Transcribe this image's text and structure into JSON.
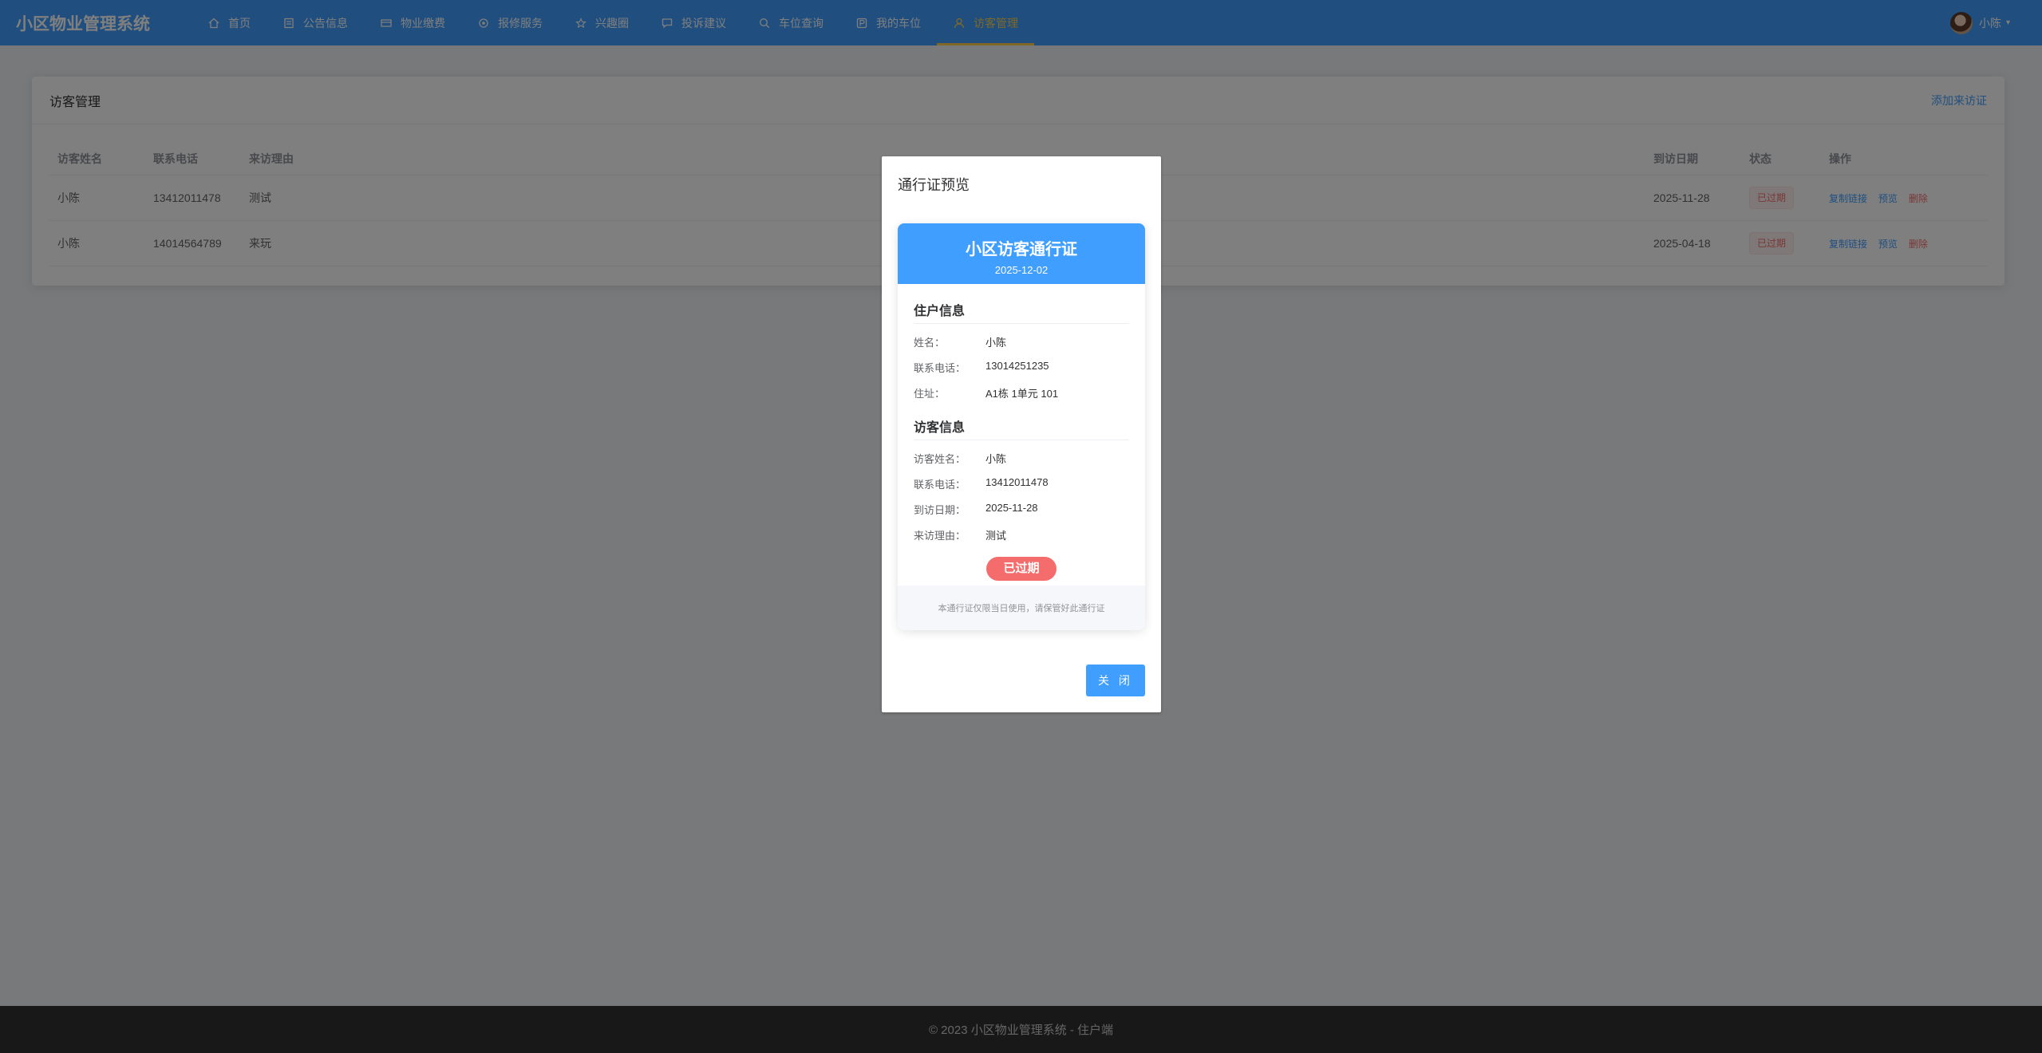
{
  "app": {
    "title": "小区物业管理系统"
  },
  "nav": [
    {
      "label": "首页",
      "icon": "home-icon"
    },
    {
      "label": "公告信息",
      "icon": "notice-icon"
    },
    {
      "label": "物业缴费",
      "icon": "payment-icon"
    },
    {
      "label": "报修服务",
      "icon": "repair-icon"
    },
    {
      "label": "兴趣圈",
      "icon": "circle-icon"
    },
    {
      "label": "投诉建议",
      "icon": "complaint-icon"
    },
    {
      "label": "车位查询",
      "icon": "parking-icon"
    },
    {
      "label": "我的车位",
      "icon": "my-parking-icon"
    },
    {
      "label": "访客管理",
      "icon": "user-icon",
      "active": true
    }
  ],
  "user": {
    "name": "小陈"
  },
  "card": {
    "title": "访客管理",
    "add_label": "添加来访证"
  },
  "table": {
    "headers": [
      "访客姓名",
      "联系电话",
      "来访理由",
      "到访日期",
      "状态",
      "操作"
    ],
    "rows": [
      {
        "name": "小陈",
        "phone": "13412011478",
        "reason": "测试",
        "date": "2025-11-28",
        "status": "已过期"
      },
      {
        "name": "小陈",
        "phone": "14014564789",
        "reason": "来玩",
        "date": "2025-04-18",
        "status": "已过期"
      }
    ],
    "actions": {
      "copy": "复制链接",
      "preview": "预览",
      "delete": "删除"
    }
  },
  "footer": {
    "text": "© 2023 小区物业管理系统 - 住户端"
  },
  "dialog": {
    "title": "通行证预览",
    "pass_title": "小区访客通行证",
    "pass_date": "2025-12-02",
    "resident_section": "住户信息",
    "resident": [
      {
        "k": "姓名：",
        "v": "小陈"
      },
      {
        "k": "联系电话：",
        "v": "13014251235"
      },
      {
        "k": "住址：",
        "v": "A1栋 1单元 101"
      }
    ],
    "visitor_section": "访客信息",
    "visitor": [
      {
        "k": "访客姓名：",
        "v": "小陈"
      },
      {
        "k": "联系电话：",
        "v": "13412011478"
      },
      {
        "k": "到访日期：",
        "v": "2025-11-28"
      },
      {
        "k": "来访理由：",
        "v": "测试"
      }
    ],
    "status": "已过期",
    "notice": "本通行证仅限当日使用，请保管好此通行证",
    "close_label": "关 闭"
  },
  "colors": {
    "primary": "#409eff",
    "danger": "#f56c6c",
    "active": "#ffd04b"
  }
}
